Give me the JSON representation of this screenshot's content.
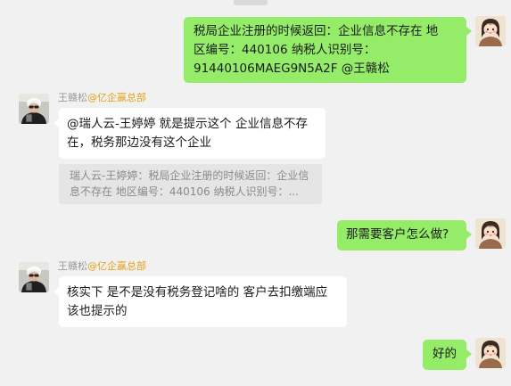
{
  "messages": [
    {
      "side": "right",
      "lines": [
        "税局企业注册的时候返回：企业信息不存在    地",
        "区编号：440106   纳税人识别号：",
        "91440106MAEG9N5A2F  @王赣松"
      ]
    },
    {
      "side": "left",
      "sender_name": "王赣松",
      "sender_org": "@亿企赢总部",
      "lines": [
        "@瑞人云-王婷婷 就是提示这个 企业信息不存",
        "在，税务那边没有这个企业"
      ],
      "quote_lines": [
        "瑞人云-王婷婷：税局企业注册的时候返回：企业信",
        "息不存在    地区编号：440106   纳税人识别号：..."
      ]
    },
    {
      "side": "right",
      "lines": [
        "那需要客户怎么做?"
      ]
    },
    {
      "side": "left",
      "sender_name": "王赣松",
      "sender_org": "@亿企赢总部",
      "lines": [
        "核实下 是不是没有税务登记啥的 客户去扣缴端应",
        "该也提示的"
      ]
    },
    {
      "side": "right",
      "lines": [
        "好的"
      ]
    }
  ],
  "colors": {
    "background": "#f1f1f1",
    "self_bubble": "#95ec69",
    "other_bubble": "#ffffff",
    "org_tag": "#e3a21a"
  },
  "icons": {
    "self_avatar": "cartoon-girl-avatar-icon",
    "other_avatar": "selfie-man-avatar-icon"
  }
}
